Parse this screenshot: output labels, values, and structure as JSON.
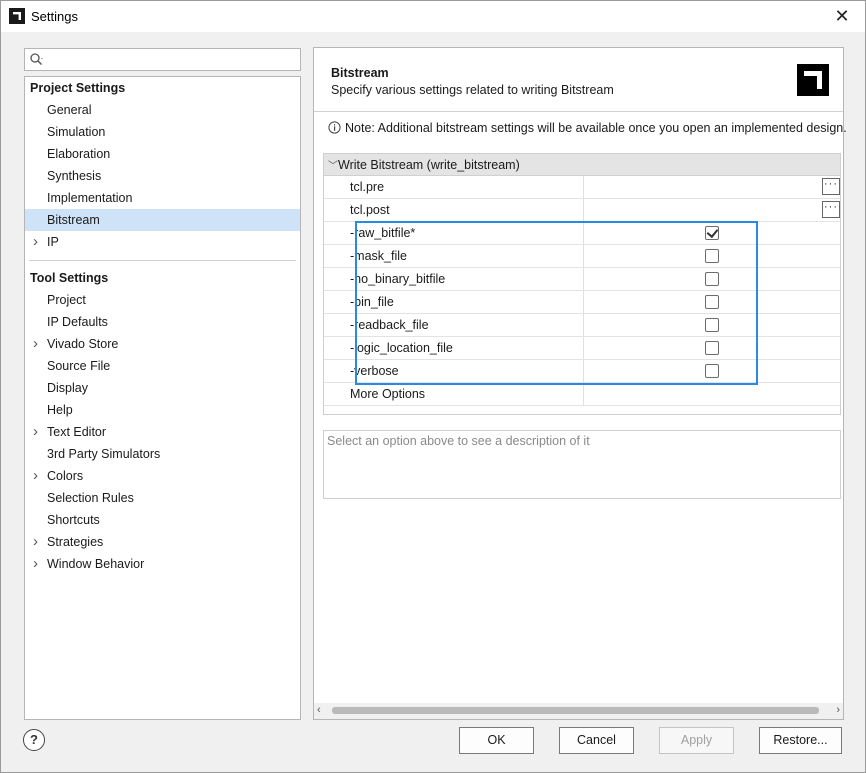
{
  "window": {
    "title": "Settings",
    "close_glyph": "✕"
  },
  "search": {
    "placeholder": ""
  },
  "tree": {
    "project_section": "Project Settings",
    "project_items": [
      {
        "label": "General"
      },
      {
        "label": "Simulation"
      },
      {
        "label": "Elaboration"
      },
      {
        "label": "Synthesis"
      },
      {
        "label": "Implementation"
      },
      {
        "label": "Bitstream",
        "selected": true
      },
      {
        "label": "IP",
        "expandable": true
      }
    ],
    "tool_section": "Tool Settings",
    "tool_items": [
      {
        "label": "Project"
      },
      {
        "label": "IP Defaults"
      },
      {
        "label": "Vivado Store",
        "expandable": true
      },
      {
        "label": "Source File"
      },
      {
        "label": "Display"
      },
      {
        "label": "Help"
      },
      {
        "label": "Text Editor",
        "expandable": true
      },
      {
        "label": "3rd Party Simulators"
      },
      {
        "label": "Colors",
        "expandable": true
      },
      {
        "label": "Selection Rules"
      },
      {
        "label": "Shortcuts"
      },
      {
        "label": "Strategies",
        "expandable": true
      },
      {
        "label": "Window Behavior",
        "expandable": true
      }
    ]
  },
  "header": {
    "title": "Bitstream",
    "subtitle": "Specify various settings related to writing Bitstream"
  },
  "note": "Note: Additional bitstream settings will be available once you open an implemented design.",
  "group": {
    "title": "Write Bitstream (write_bitstream)",
    "tcl_rows": [
      {
        "name": "tcl.pre",
        "button": "···"
      },
      {
        "name": "tcl.post",
        "button": "···"
      }
    ],
    "options": [
      {
        "name": "-raw_bitfile*",
        "checked": true
      },
      {
        "name": "-mask_file",
        "checked": false
      },
      {
        "name": "-no_binary_bitfile",
        "checked": false
      },
      {
        "name": "-bin_file",
        "checked": false
      },
      {
        "name": "-readback_file",
        "checked": false
      },
      {
        "name": "-logic_location_file",
        "checked": false
      },
      {
        "name": "-verbose",
        "checked": false
      }
    ],
    "more_options": "More Options"
  },
  "description_placeholder": "Select an option above to see a description of it",
  "scroll": {
    "left": "‹",
    "right": "›"
  },
  "buttons": {
    "help": "?",
    "ok": "OK",
    "cancel": "Cancel",
    "apply": "Apply",
    "restore": "Restore..."
  },
  "colors": {
    "selection": "#cfe3f8",
    "highlight_border": "#2a8ae0"
  }
}
